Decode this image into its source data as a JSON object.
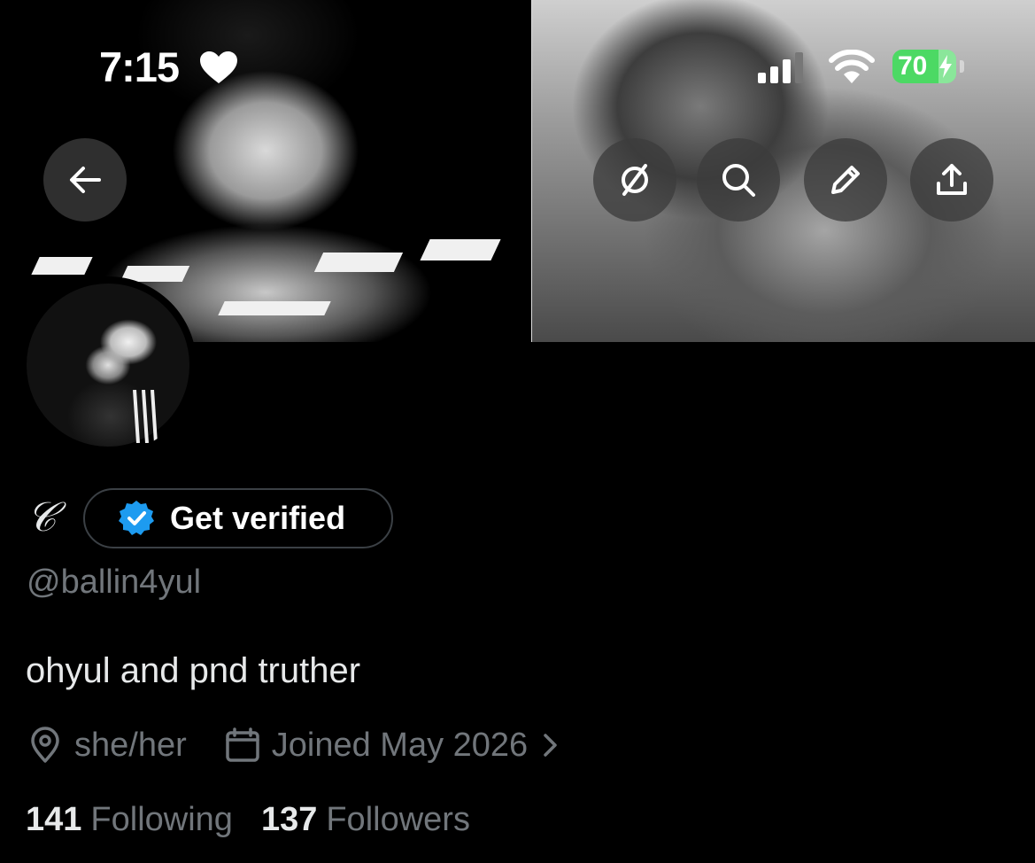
{
  "status_bar": {
    "time": "7:15",
    "battery_percent": "70",
    "battery_color": "#4cd964",
    "icons": [
      "heart-icon",
      "signal-icon",
      "wifi-icon",
      "battery-icon",
      "charging-bolt-icon"
    ]
  },
  "header": {
    "buttons": [
      {
        "name": "back-button",
        "icon": "arrow-left-icon"
      },
      {
        "name": "grok-button",
        "icon": "grok-icon"
      },
      {
        "name": "search-button",
        "icon": "search-icon"
      },
      {
        "name": "edit-button",
        "icon": "pencil-icon"
      },
      {
        "name": "share-button",
        "icon": "share-icon"
      }
    ]
  },
  "profile": {
    "display_name": "𝒞",
    "verify_label": "Get verified",
    "handle": "@ballin4yul",
    "bio": "ohyul and pnd truther",
    "location": "she/her",
    "joined": "Joined May 2026",
    "following_count": "141",
    "following_label": "Following",
    "followers_count": "137",
    "followers_label": "Followers"
  },
  "colors": {
    "background": "#000000",
    "text_primary": "#e7e9ea",
    "text_secondary": "#71767b",
    "verified_blue": "#1d9bf0"
  }
}
